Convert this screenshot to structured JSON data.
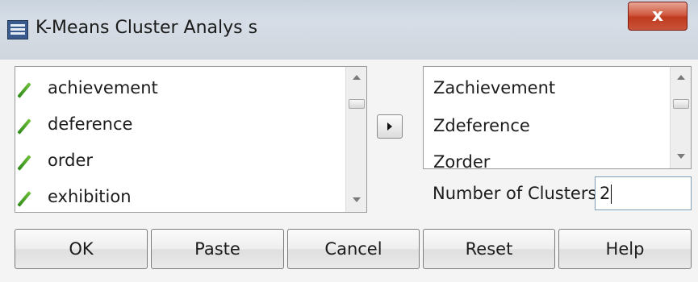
{
  "window": {
    "title": "K-Means Cluster Analys s",
    "close_glyph": "x"
  },
  "variables_list": {
    "items": [
      "achievement",
      "deference",
      "order",
      "exhibition"
    ]
  },
  "selected_list": {
    "items": [
      "Zachievement",
      "Zdeference",
      "Zorder"
    ]
  },
  "clusters": {
    "label": "Number of Clusters:",
    "value": "2"
  },
  "buttons": {
    "ok": "OK",
    "paste": "Paste",
    "cancel": "Cancel",
    "reset": "Reset",
    "help": "Help"
  },
  "icons": {
    "app": "spss-app-icon",
    "variable": "scale-variable-pencil-icon",
    "move": "move-right-arrow-icon"
  }
}
